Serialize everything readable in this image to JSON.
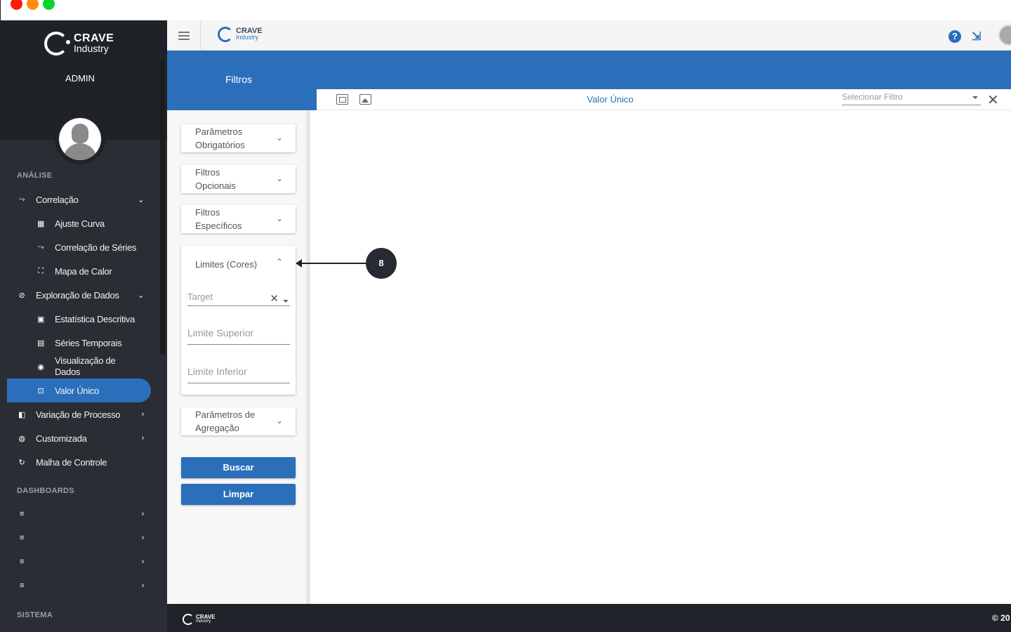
{
  "window": {
    "controls": [
      "close",
      "minimize",
      "maximize"
    ]
  },
  "sidebar": {
    "brand": {
      "line1": "CRAVE",
      "line2": "Industry"
    },
    "role": "ADMIN",
    "sections": {
      "analise": "ANÁLISE",
      "dashboards": "DASHBOARDS",
      "sistema": "SISTEMA"
    },
    "items": [
      {
        "label": "Correlação",
        "icon": "correlation-icon",
        "chevron": "⌄"
      },
      {
        "label": "Ajuste Curva",
        "icon": "curve-fit-icon"
      },
      {
        "label": "Correlação de Séries",
        "icon": "series-correlation-icon"
      },
      {
        "label": "Mapa de Calor",
        "icon": "heatmap-icon"
      },
      {
        "label": "Exploração de Dados",
        "icon": "explore-icon",
        "chevron": "⌄"
      },
      {
        "label": "Estatística Descritiva",
        "icon": "statistics-icon"
      },
      {
        "label": "Séries Temporais",
        "icon": "timeseries-icon"
      },
      {
        "label": "Visualização de Dados",
        "icon": "eye-icon"
      },
      {
        "label": "Valor Único",
        "icon": "single-value-icon",
        "active": true
      },
      {
        "label": "Variação de Processo",
        "icon": "process-variation-icon",
        "chevron": "›"
      },
      {
        "label": "Customizada",
        "icon": "palette-icon",
        "chevron": "›"
      },
      {
        "label": "Malha de Controle",
        "icon": "refresh-icon"
      }
    ],
    "dashboards": [
      {
        "label": "",
        "chevron": "›"
      },
      {
        "label": "",
        "chevron": "›"
      },
      {
        "label": "",
        "chevron": "›"
      },
      {
        "label": "",
        "chevron": "›"
      }
    ]
  },
  "topbar": {
    "logo": {
      "line1": "CRAVE",
      "line2": "Industry"
    },
    "help_icon": "question-circle-icon",
    "compress_icon": "compress-icon"
  },
  "filters": {
    "title": "Filtros",
    "accordions": {
      "obrigatorios": "Parâmetros Obrigatórios",
      "opcionais": "Filtros Opcionais",
      "especificos": "Filtros Específicos",
      "limites": "Limites (Cores)",
      "agregacao": "Parâmetros de Agregação"
    },
    "limites_fields": {
      "target_placeholder": "Target",
      "limite_superior_placeholder": "Limite Superior",
      "limite_inferior_placeholder": "Limite Inferior"
    },
    "buttons": {
      "buscar": "Buscar",
      "limpar": "Limpar"
    }
  },
  "content": {
    "title": "Valor Único",
    "select_placeholder": "Selecionar Filtro"
  },
  "annotation": {
    "number": "8"
  },
  "footer": {
    "logo": {
      "line1": "CRAVE",
      "line2": "Industry"
    },
    "copyright": "© 20"
  },
  "colors": {
    "primary": "#2b6fbb",
    "sidebar": "#2a2d33",
    "footer": "#202329"
  }
}
